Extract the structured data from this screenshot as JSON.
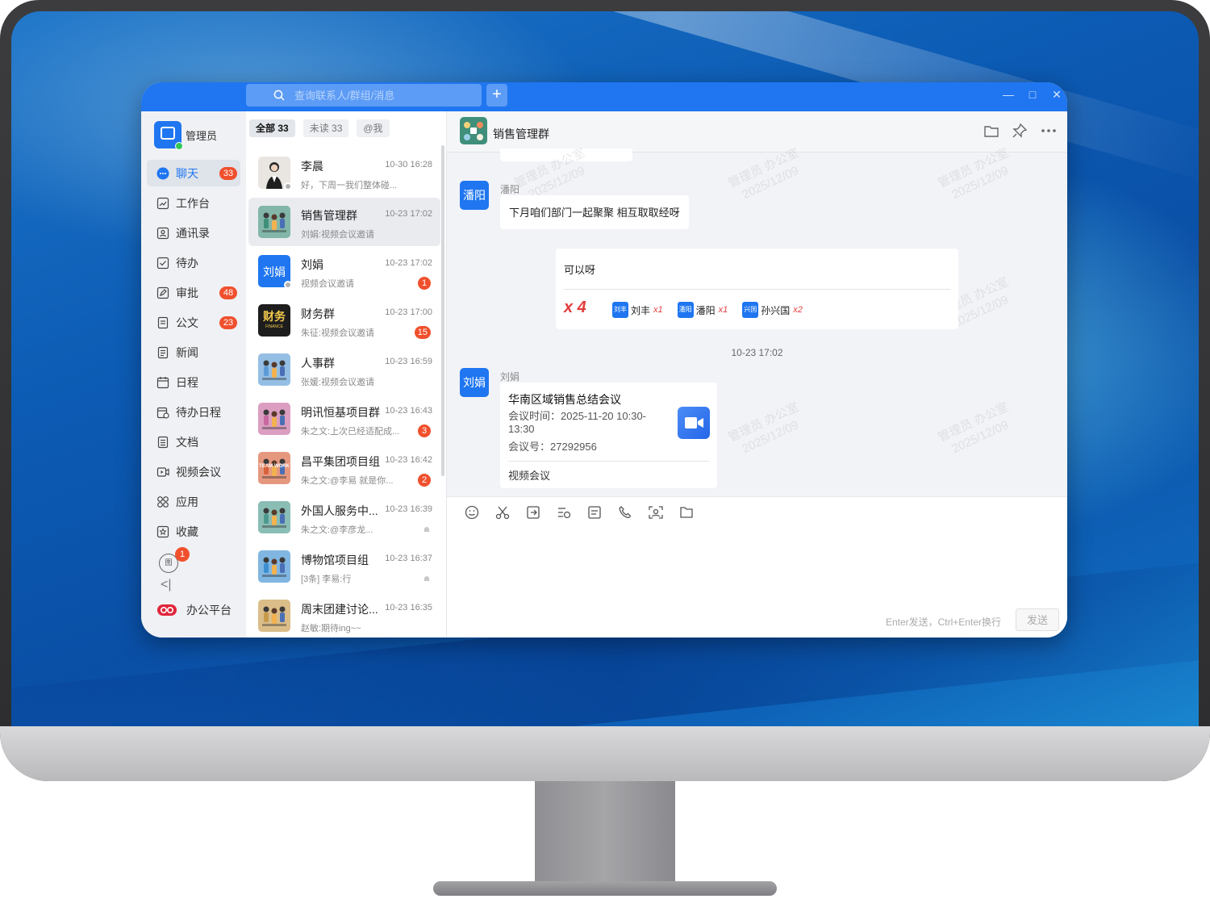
{
  "app": {
    "search_placeholder": "查询联系人/群组/消息",
    "plus_label": "+",
    "window_controls": {
      "minimize": "—",
      "maximize": "□",
      "close": "✕"
    }
  },
  "sidebar": {
    "username": "管理员",
    "items": [
      {
        "label": "聊天",
        "badge": "33",
        "icon": "chat-icon",
        "active": true
      },
      {
        "label": "工作台",
        "badge": "",
        "icon": "workbench-icon"
      },
      {
        "label": "通讯录",
        "badge": "",
        "icon": "contacts-icon"
      },
      {
        "label": "待办",
        "badge": "",
        "icon": "todo-icon"
      },
      {
        "label": "审批",
        "badge": "48",
        "icon": "approval-icon"
      },
      {
        "label": "公文",
        "badge": "23",
        "icon": "document-icon"
      },
      {
        "label": "新闻",
        "badge": "",
        "icon": "news-icon"
      },
      {
        "label": "日程",
        "badge": "",
        "icon": "calendar-icon"
      },
      {
        "label": "待办日程",
        "badge": "",
        "icon": "todo-calendar-icon"
      },
      {
        "label": "文档",
        "badge": "",
        "icon": "docs-icon"
      },
      {
        "label": "视频会议",
        "badge": "",
        "icon": "video-icon"
      },
      {
        "label": "应用",
        "badge": "",
        "icon": "apps-icon"
      },
      {
        "label": "收藏",
        "badge": "",
        "icon": "favorites-icon"
      }
    ],
    "extra_badge": "1",
    "extra_label": "图",
    "collapse_icon": "<|",
    "platform_label": "办公平台"
  },
  "tabs": [
    {
      "label": "全部 33",
      "active": true
    },
    {
      "label": "未读 33",
      "active": false
    },
    {
      "label": "@我",
      "active": false
    }
  ],
  "conversations": [
    {
      "name": "李晨",
      "time": "10-30 16:28",
      "preview": "好，下周一我们整体碰...",
      "badge": "",
      "muted": false,
      "avatar": "photo",
      "avatar_color": "#e9e6e2",
      "status": true
    },
    {
      "name": "销售管理群",
      "time": "10-23 17:02",
      "preview": "刘娟:视频会议邀请",
      "badge": "",
      "muted": false,
      "avatar": "group",
      "avatar_color": "#3f8f7a",
      "selected": true
    },
    {
      "name": "刘娟",
      "time": "10-23 17:02",
      "preview": "视频会议邀请",
      "badge": "1",
      "muted": false,
      "avatar": "text",
      "avatar_text": "刘娟",
      "avatar_color": "#1f76f0",
      "status": true
    },
    {
      "name": "财务群",
      "time": "10-23 17:00",
      "preview": "朱征:视频会议邀请",
      "badge": "15",
      "muted": false,
      "avatar": "text",
      "avatar_text": "财务",
      "avatar_sub": "FINANCE",
      "avatar_color": "#1d1d1d",
      "avatar_text_color": "#f2c94c"
    },
    {
      "name": "人事群",
      "time": "10-23 16:59",
      "preview": "张媛:视频会议邀请",
      "badge": "",
      "muted": false,
      "avatar": "group",
      "avatar_color": "#5d9bd6"
    },
    {
      "name": "明讯恒基项目群",
      "time": "10-23 16:43",
      "preview": "朱之文:上次已经适配成...",
      "badge": "3",
      "muted": false,
      "avatar": "group",
      "avatar_color": "#c86aa0"
    },
    {
      "name": "昌平集团项目组",
      "time": "10-23 16:42",
      "preview": "朱之文:@李易 就是你...",
      "badge": "2",
      "muted": false,
      "avatar": "group",
      "avatar_color": "#d9623b",
      "avatar_text": "TEAM WORK"
    },
    {
      "name": "外国人服务中...",
      "time": "10-23 16:39",
      "preview": "朱之文:@李彦龙...",
      "badge": "",
      "muted": true,
      "avatar": "group",
      "avatar_color": "#4c9a8d"
    },
    {
      "name": "博物馆项目组",
      "time": "10-23 16:37",
      "preview": "[3条] 李易:行",
      "badge": "",
      "muted": true,
      "avatar": "group",
      "avatar_color": "#3d8fd1"
    },
    {
      "name": "周末团建讨论...",
      "time": "10-23 16:35",
      "preview": "赵敏:期待ing~~",
      "badge": "",
      "muted": false,
      "avatar": "group",
      "avatar_color": "#c79a4a"
    }
  ],
  "chat": {
    "title": "销售管理群",
    "header_icons": [
      "folder-icon",
      "pin-icon",
      "more-icon"
    ],
    "watermark_line1": "管理员 办公室",
    "watermark_line2": "2025/12/09",
    "messages": {
      "pan": {
        "avatar": "潘阳",
        "sender": "潘阳",
        "text": "下月咱们部门一起聚聚 相互取取经呀"
      },
      "reply": {
        "text": "可以呀",
        "total": "x 4",
        "reactions": [
          {
            "avatar": "刘丰",
            "name": "刘丰",
            "count": "x1"
          },
          {
            "avatar": "潘阳",
            "name": "潘阳",
            "count": "x1"
          },
          {
            "avatar": "兴国",
            "name": "孙兴国",
            "count": "x2"
          }
        ]
      },
      "divider": "10-23 17:02",
      "liu": {
        "avatar": "刘娟",
        "sender": "刘娟",
        "card_title": "华南区域销售总结会议",
        "card_time_line1": "会议时间：2025-11-20 10:30-",
        "card_time_line2": "13:30",
        "card_id": "会议号：27292956",
        "card_footer": "视频会议"
      }
    }
  },
  "compose": {
    "tools": [
      "emoji-icon",
      "scissors-icon",
      "share-icon",
      "history-icon",
      "note-icon",
      "call-icon",
      "screen-share-icon",
      "folder-icon"
    ],
    "hint": "Enter发送，Ctrl+Enter换行",
    "send_label": "发送"
  }
}
